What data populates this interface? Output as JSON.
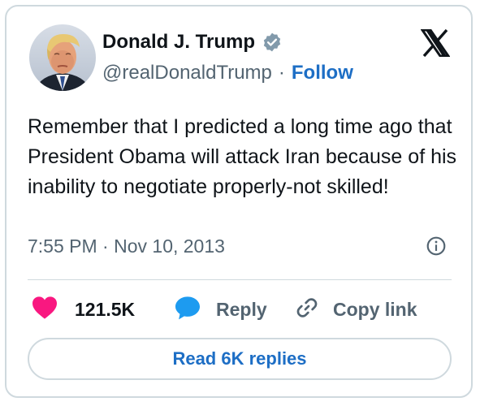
{
  "author": {
    "name": "Donald J. Trump",
    "handle": "@realDonaldTrump",
    "separator": "·",
    "follow_label": "Follow",
    "avatar_icon": "avatar-portrait",
    "verified_icon": "verified-badge-icon"
  },
  "platform_icon": "x-logo-icon",
  "tweet": {
    "text": "Remember that I predicted a long time ago that President Obama will attack Iran because of his inability to negotiate properly-not skilled!",
    "time": "7:55 PM",
    "separator": "·",
    "date": "Nov 10, 2013"
  },
  "actions": {
    "like_count": "121.5K",
    "reply_label": "Reply",
    "copy_link_label": "Copy link"
  },
  "read_replies_label": "Read 6K replies",
  "colors": {
    "link_blue": "#1d6ec5",
    "like_pink": "#f91880",
    "reply_blue": "#1d9bf0",
    "verified_gray": "#829aab",
    "secondary_text": "#536471",
    "border": "#cfd9de"
  }
}
